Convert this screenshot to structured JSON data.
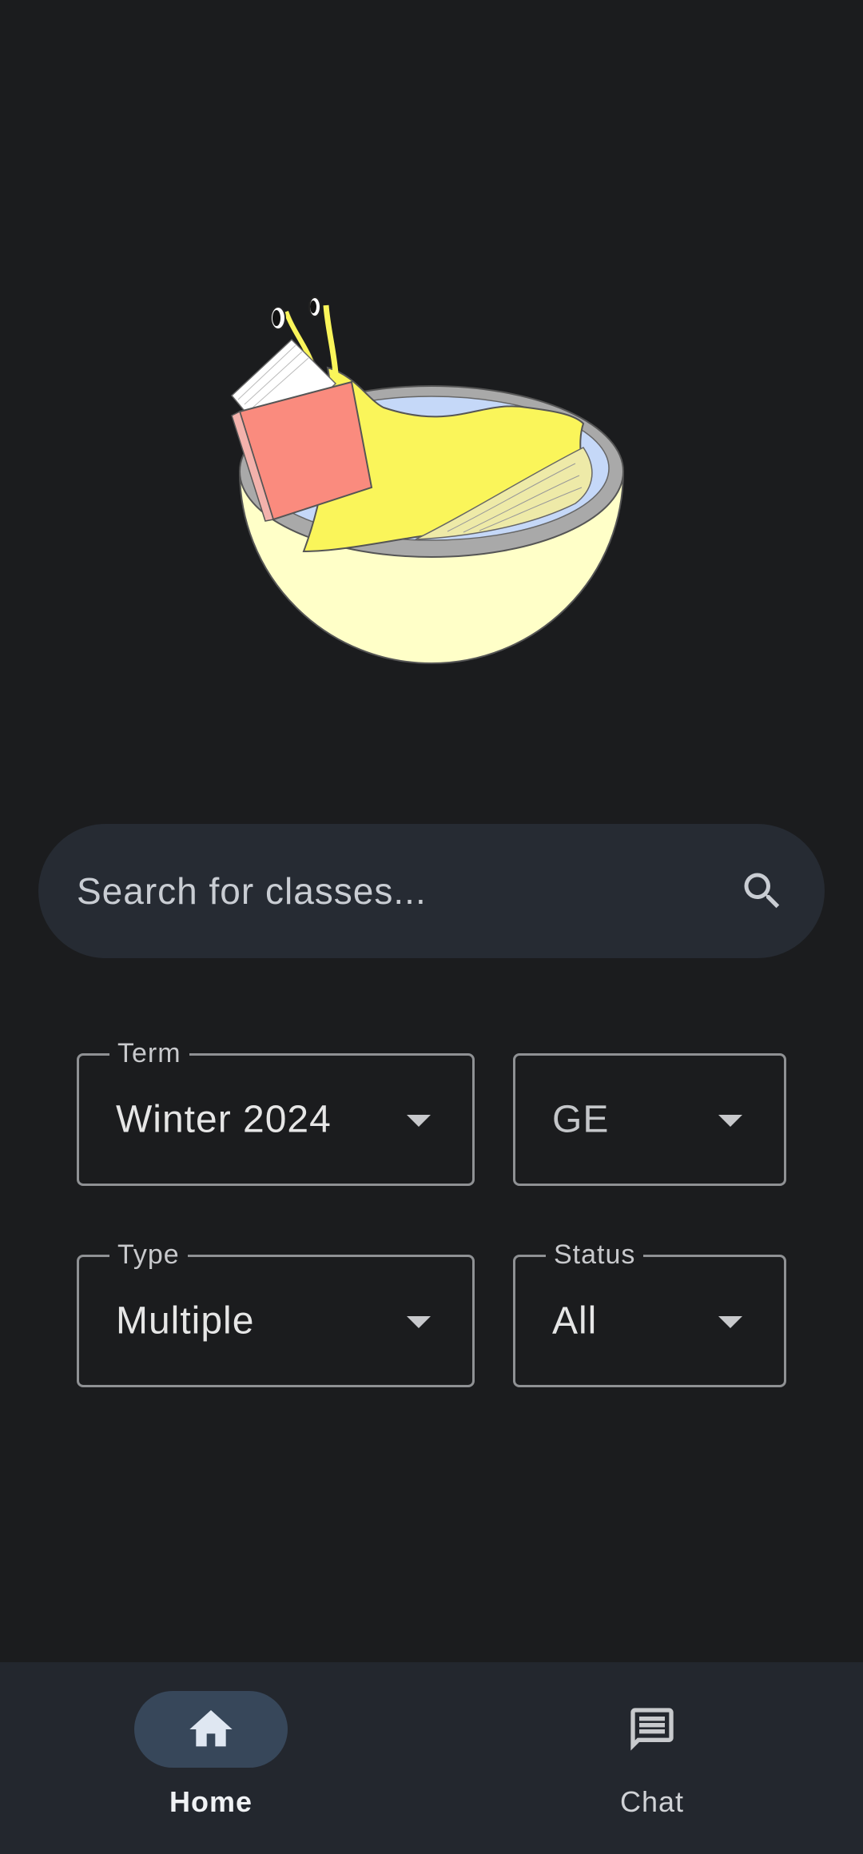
{
  "search": {
    "placeholder": "Search for classes...",
    "icon": "search-icon"
  },
  "filters": {
    "term": {
      "label": "Term",
      "value": "Winter 2024"
    },
    "ge": {
      "label": "",
      "value": "GE"
    },
    "type": {
      "label": "Type",
      "value": "Multiple"
    },
    "status": {
      "label": "Status",
      "value": "All"
    }
  },
  "nav": {
    "items": [
      {
        "label": "Home",
        "icon": "home-icon",
        "active": true
      },
      {
        "label": "Chat",
        "icon": "chat-icon",
        "active": false
      }
    ]
  },
  "colors": {
    "background": "#1b1c1e",
    "surface": "#262b33",
    "nav_active": "#37475a",
    "outline": "#8f9194"
  }
}
